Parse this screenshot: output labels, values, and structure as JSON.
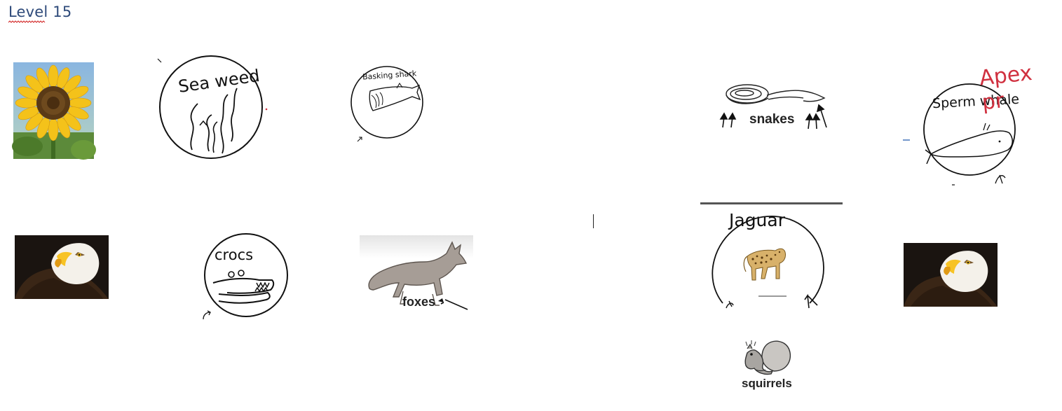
{
  "document": {
    "title": "Level 15"
  },
  "cards": {
    "seaweed": "Sea weed",
    "basking_shark": "Basking shark",
    "snakes": "snakes",
    "sperm_whale": "Sperm whale",
    "apex_note": "Apex pr",
    "crocs": "crocs",
    "foxes": "foxes",
    "jaguar": "Jaguar",
    "squirrels": "squirrels"
  },
  "colors": {
    "title": "#2e4a7a",
    "ink": "#111111",
    "annotation_red": "#d0303f",
    "spellcheck_red": "#d22222",
    "pen_blue": "#2a5fb0"
  }
}
